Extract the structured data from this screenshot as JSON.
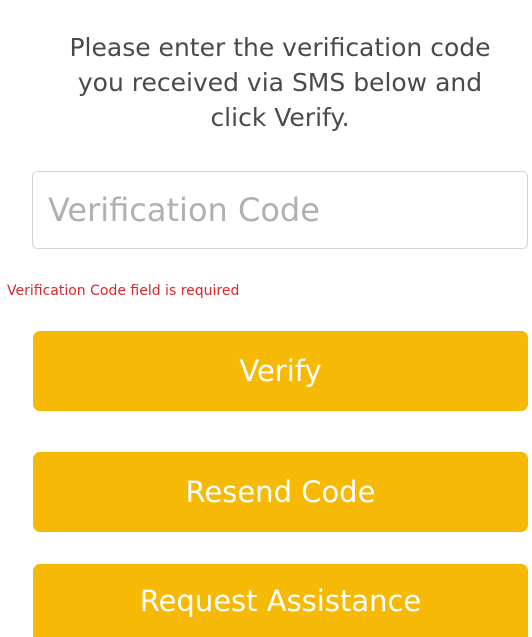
{
  "instructions": {
    "line1": "Please enter the verification code",
    "line2": "you received via SMS below and",
    "line3": "click Verify."
  },
  "form": {
    "code_placeholder": "Verification Code",
    "code_value": "",
    "error_message": "Verification Code field is required"
  },
  "buttons": {
    "verify": "Verify",
    "resend": "Resend Code",
    "assistance": "Request Assistance"
  },
  "colors": {
    "button_background": "#f6b906",
    "button_text": "#ffffff",
    "error_text": "#d9262b",
    "instruction_text": "#4a4a4a",
    "placeholder_text": "#b0b0b0"
  }
}
